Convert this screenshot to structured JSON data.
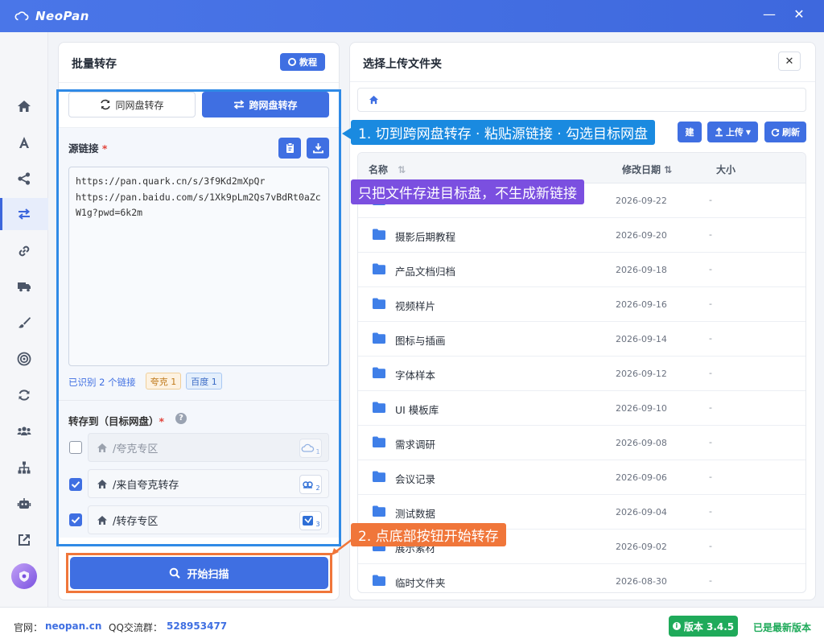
{
  "app": {
    "title": "NeoPan"
  },
  "window": {
    "minimize_icon": "minus-icon",
    "close_icon": "close-icon"
  },
  "sidebar": {
    "items": [
      {
        "name": "home",
        "icon": "home-icon"
      },
      {
        "name": "font",
        "icon": "font-icon"
      },
      {
        "name": "share",
        "icon": "share-icon"
      },
      {
        "name": "transfer",
        "icon": "transfer-icon",
        "active": true
      },
      {
        "name": "link",
        "icon": "link-icon"
      },
      {
        "name": "truck",
        "icon": "truck-icon"
      },
      {
        "name": "brush",
        "icon": "brush-icon"
      },
      {
        "name": "target",
        "icon": "target-icon"
      },
      {
        "name": "sync",
        "icon": "sync-icon"
      },
      {
        "name": "users",
        "icon": "users-icon"
      },
      {
        "name": "sitemap",
        "icon": "sitemap-icon"
      },
      {
        "name": "robot",
        "icon": "robot-icon"
      },
      {
        "name": "external",
        "icon": "external-link-icon"
      }
    ]
  },
  "left_panel": {
    "title": "批量转存",
    "tutorial_label": "教程",
    "tabs": [
      {
        "label": "同网盘转存",
        "active": false
      },
      {
        "label": "跨网盘转存",
        "active": true
      }
    ],
    "source": {
      "label": "源链接",
      "required_mark": "*",
      "text": "https://pan.quark.cn/s/3f9Kd2mXpQr\nhttps://pan.baidu.com/s/1Xk9pLm2Qs7vBdRt0aZcW1g?pwd=6k2m"
    },
    "recognized": {
      "text": "已识别 2 个链接",
      "quark_badge": "夸克 1",
      "baidu_badge": "百度 1"
    },
    "target": {
      "label": "转存到（目标网盘）",
      "required_mark": "*",
      "help_icon": "question-icon",
      "rows": [
        {
          "path": "/夸克专区",
          "checked": false,
          "disabled": true,
          "tag": "1"
        },
        {
          "path": "/来自夸克转存",
          "checked": true,
          "disabled": false,
          "tag": "2"
        },
        {
          "path": "/转存专区",
          "checked": true,
          "disabled": false,
          "tag": "3"
        }
      ]
    },
    "start_button": "开始扫描"
  },
  "right_panel": {
    "title": "选择上传文件夹",
    "new_folder_tail": "建",
    "upload_label": "上传",
    "refresh_label": "刷新",
    "columns": {
      "name": "名称",
      "date": "修改日期",
      "size": "大小"
    },
    "files": [
      {
        "name": "",
        "date": "2026-09-22",
        "size": "-"
      },
      {
        "name": "摄影后期教程",
        "date": "2026-09-20",
        "size": "-"
      },
      {
        "name": "产品文档归档",
        "date": "2026-09-18",
        "size": "-"
      },
      {
        "name": "视频样片",
        "date": "2026-09-16",
        "size": "-"
      },
      {
        "name": "图标与插画",
        "date": "2026-09-14",
        "size": "-"
      },
      {
        "name": "字体样本",
        "date": "2026-09-12",
        "size": "-"
      },
      {
        "name": "UI 模板库",
        "date": "2026-09-10",
        "size": "-"
      },
      {
        "name": "需求调研",
        "date": "2026-09-08",
        "size": "-"
      },
      {
        "name": "会议记录",
        "date": "2026-09-06",
        "size": "-"
      },
      {
        "name": "测试数据",
        "date": "2026-09-04",
        "size": "-"
      },
      {
        "name": "展示素材",
        "date": "2026-09-02",
        "size": "-"
      },
      {
        "name": "临时文件夹",
        "date": "2026-08-30",
        "size": "-"
      }
    ]
  },
  "callouts": {
    "step1": "1. 切到跨网盘转存 · 粘贴源链接 · 勾选目标网盘",
    "note": "只把文件存进目标盘，不生成新链接",
    "step2": "2. 点底部按钮开始转存"
  },
  "footer": {
    "site_label": "官网：",
    "site": "neopan.cn",
    "qq_label": "QQ交流群：",
    "qq": "528953477",
    "version": "版本 3.4.5",
    "latest": "已是最新版本"
  },
  "colors": {
    "accent": "#3f6fe2",
    "highlight": "#2f8ae6",
    "orange": "#f0763a",
    "purple": "#7b4fe0",
    "green": "#1faa5a"
  }
}
